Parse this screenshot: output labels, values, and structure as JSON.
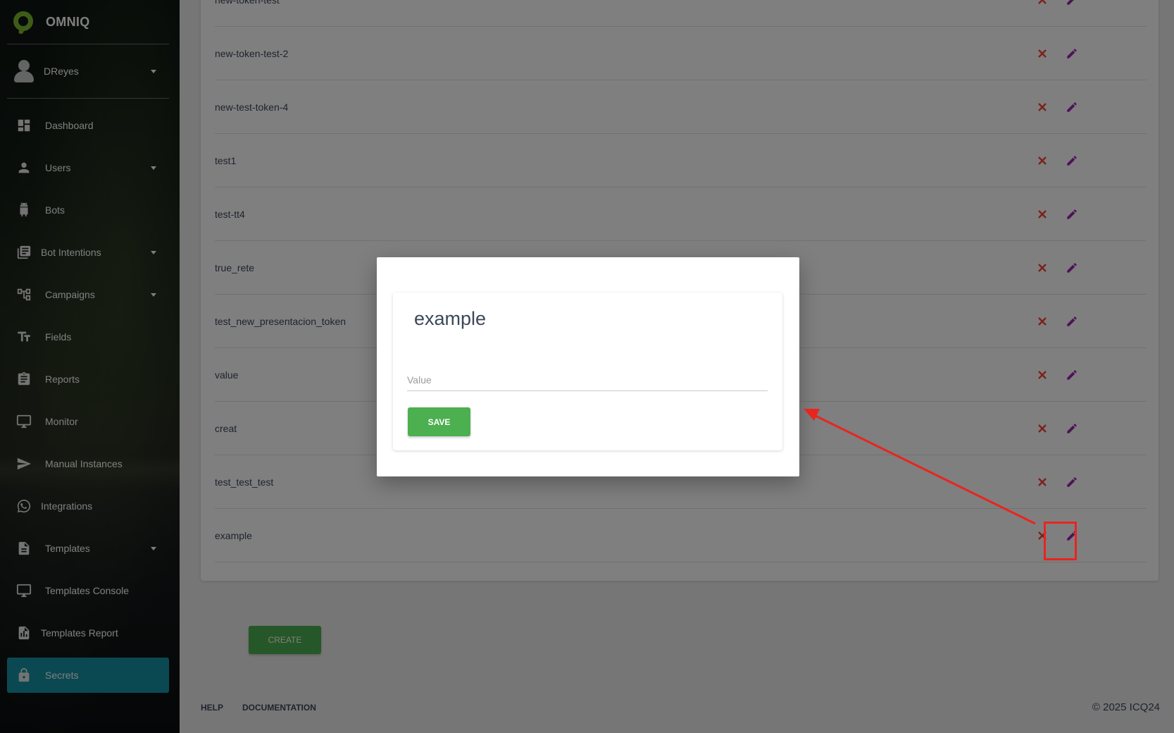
{
  "app": {
    "name": "OMNIQ"
  },
  "user": {
    "name": "DReyes"
  },
  "sidebar": {
    "items": [
      {
        "label": "Dashboard",
        "icon": "dashboard-icon",
        "has_caret": false
      },
      {
        "label": "Users",
        "icon": "person-icon",
        "has_caret": true
      },
      {
        "label": "Bots",
        "icon": "android-icon",
        "has_caret": false
      },
      {
        "label": "Bot Intentions",
        "icon": "library-books-icon",
        "has_caret": true
      },
      {
        "label": "Campaigns",
        "icon": "hierarchy-icon",
        "has_caret": true
      },
      {
        "label": "Fields",
        "icon": "text-fields-icon",
        "has_caret": false
      },
      {
        "label": "Reports",
        "icon": "clipboard-icon",
        "has_caret": false
      },
      {
        "label": "Monitor",
        "icon": "desktop-icon",
        "has_caret": false
      },
      {
        "label": "Manual Instances",
        "icon": "send-icon",
        "has_caret": false
      },
      {
        "label": "Integrations",
        "icon": "whatsapp-icon",
        "has_caret": false
      },
      {
        "label": "Templates",
        "icon": "document-icon",
        "has_caret": true
      },
      {
        "label": "Templates Console",
        "icon": "desktop-icon",
        "has_caret": false
      },
      {
        "label": "Templates Report",
        "icon": "report-icon",
        "has_caret": false
      },
      {
        "label": "Secrets",
        "icon": "lock-icon",
        "has_caret": false,
        "active": true
      }
    ]
  },
  "secrets": {
    "rows": [
      "new-token-test",
      "new-token-test-2",
      "new-test-token-4",
      "test1",
      "test-tt4",
      "true_rete",
      "test_new_presentacion_token",
      "value",
      "creat",
      "test_test_test",
      "example"
    ]
  },
  "create_label": "CREATE",
  "footer": {
    "help": "HELP",
    "documentation": "DOCUMENTATION",
    "copyright": "© 2025 ICQ24"
  },
  "modal": {
    "title": "example",
    "input_placeholder": "Value",
    "save_label": "SAVE"
  },
  "colors": {
    "accent_active": "#1693a5",
    "button_green": "#4caf50",
    "delete_red": "#f44336",
    "edit_purple": "#9c27b0",
    "annotation_red": "#e8251f",
    "logo_green": "#7cb82f"
  }
}
